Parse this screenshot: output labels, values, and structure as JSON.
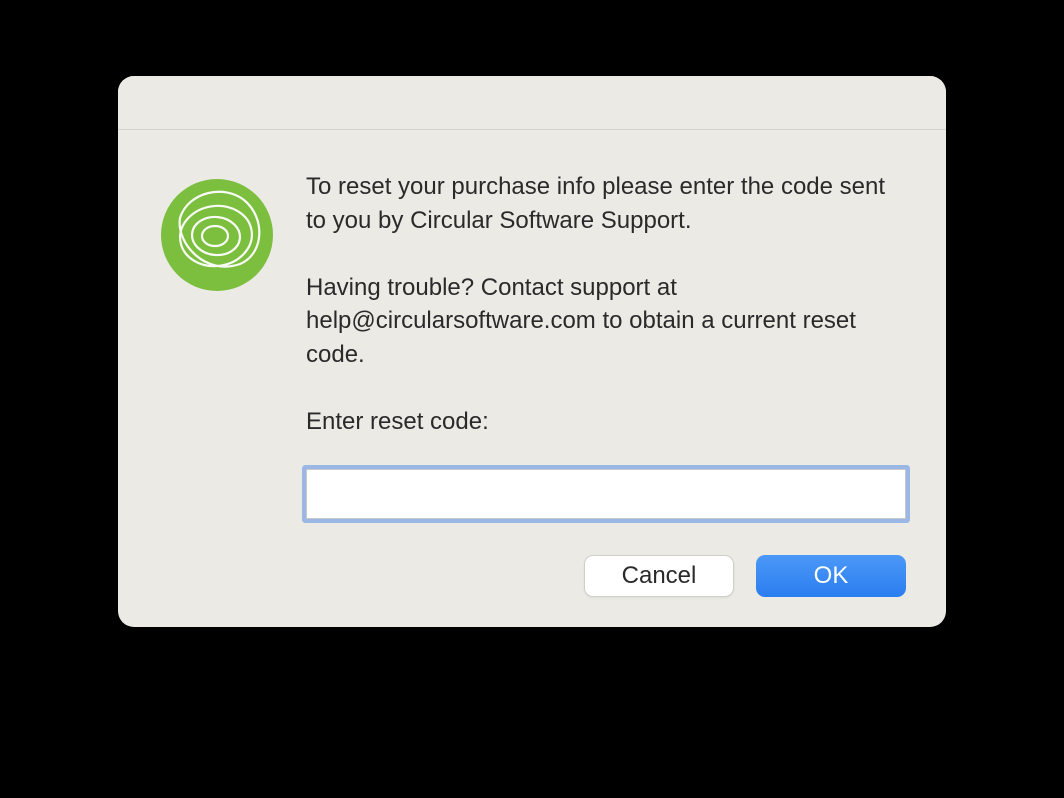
{
  "dialog": {
    "message": "To reset your purchase info please enter the code sent to you by Circular Software Support.\n\nHaving trouble? Contact support at help@circularsoftware.com to obtain a current reset code.\n\nEnter reset code:",
    "input": {
      "value": "",
      "placeholder": ""
    },
    "buttons": {
      "cancel": "Cancel",
      "ok": "OK"
    }
  },
  "colors": {
    "accent_green": "#7bbf3e",
    "accent_blue": "#3a87f2",
    "focus_ring": "#9ab7e6"
  }
}
